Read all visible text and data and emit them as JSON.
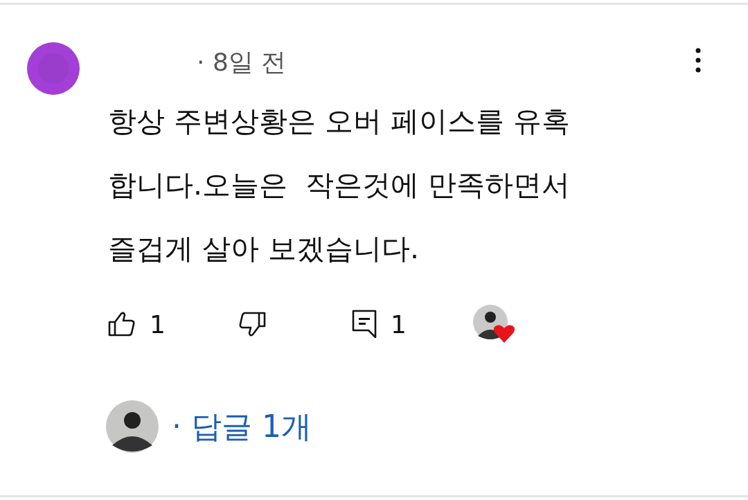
{
  "comment": {
    "meta": "· 8일 전",
    "text_lines": [
      "항상 주변상황은 오버 페이스를 유혹",
      "합니다.오늘은  작은것에 만족하면서",
      "즐겁게 살아 보겠습니다."
    ],
    "like_count": "1",
    "liked": false,
    "disliked": false,
    "reply_count_icon_label": "1",
    "creator_hearted": true
  },
  "replies": {
    "label": "· 답글 1개"
  }
}
